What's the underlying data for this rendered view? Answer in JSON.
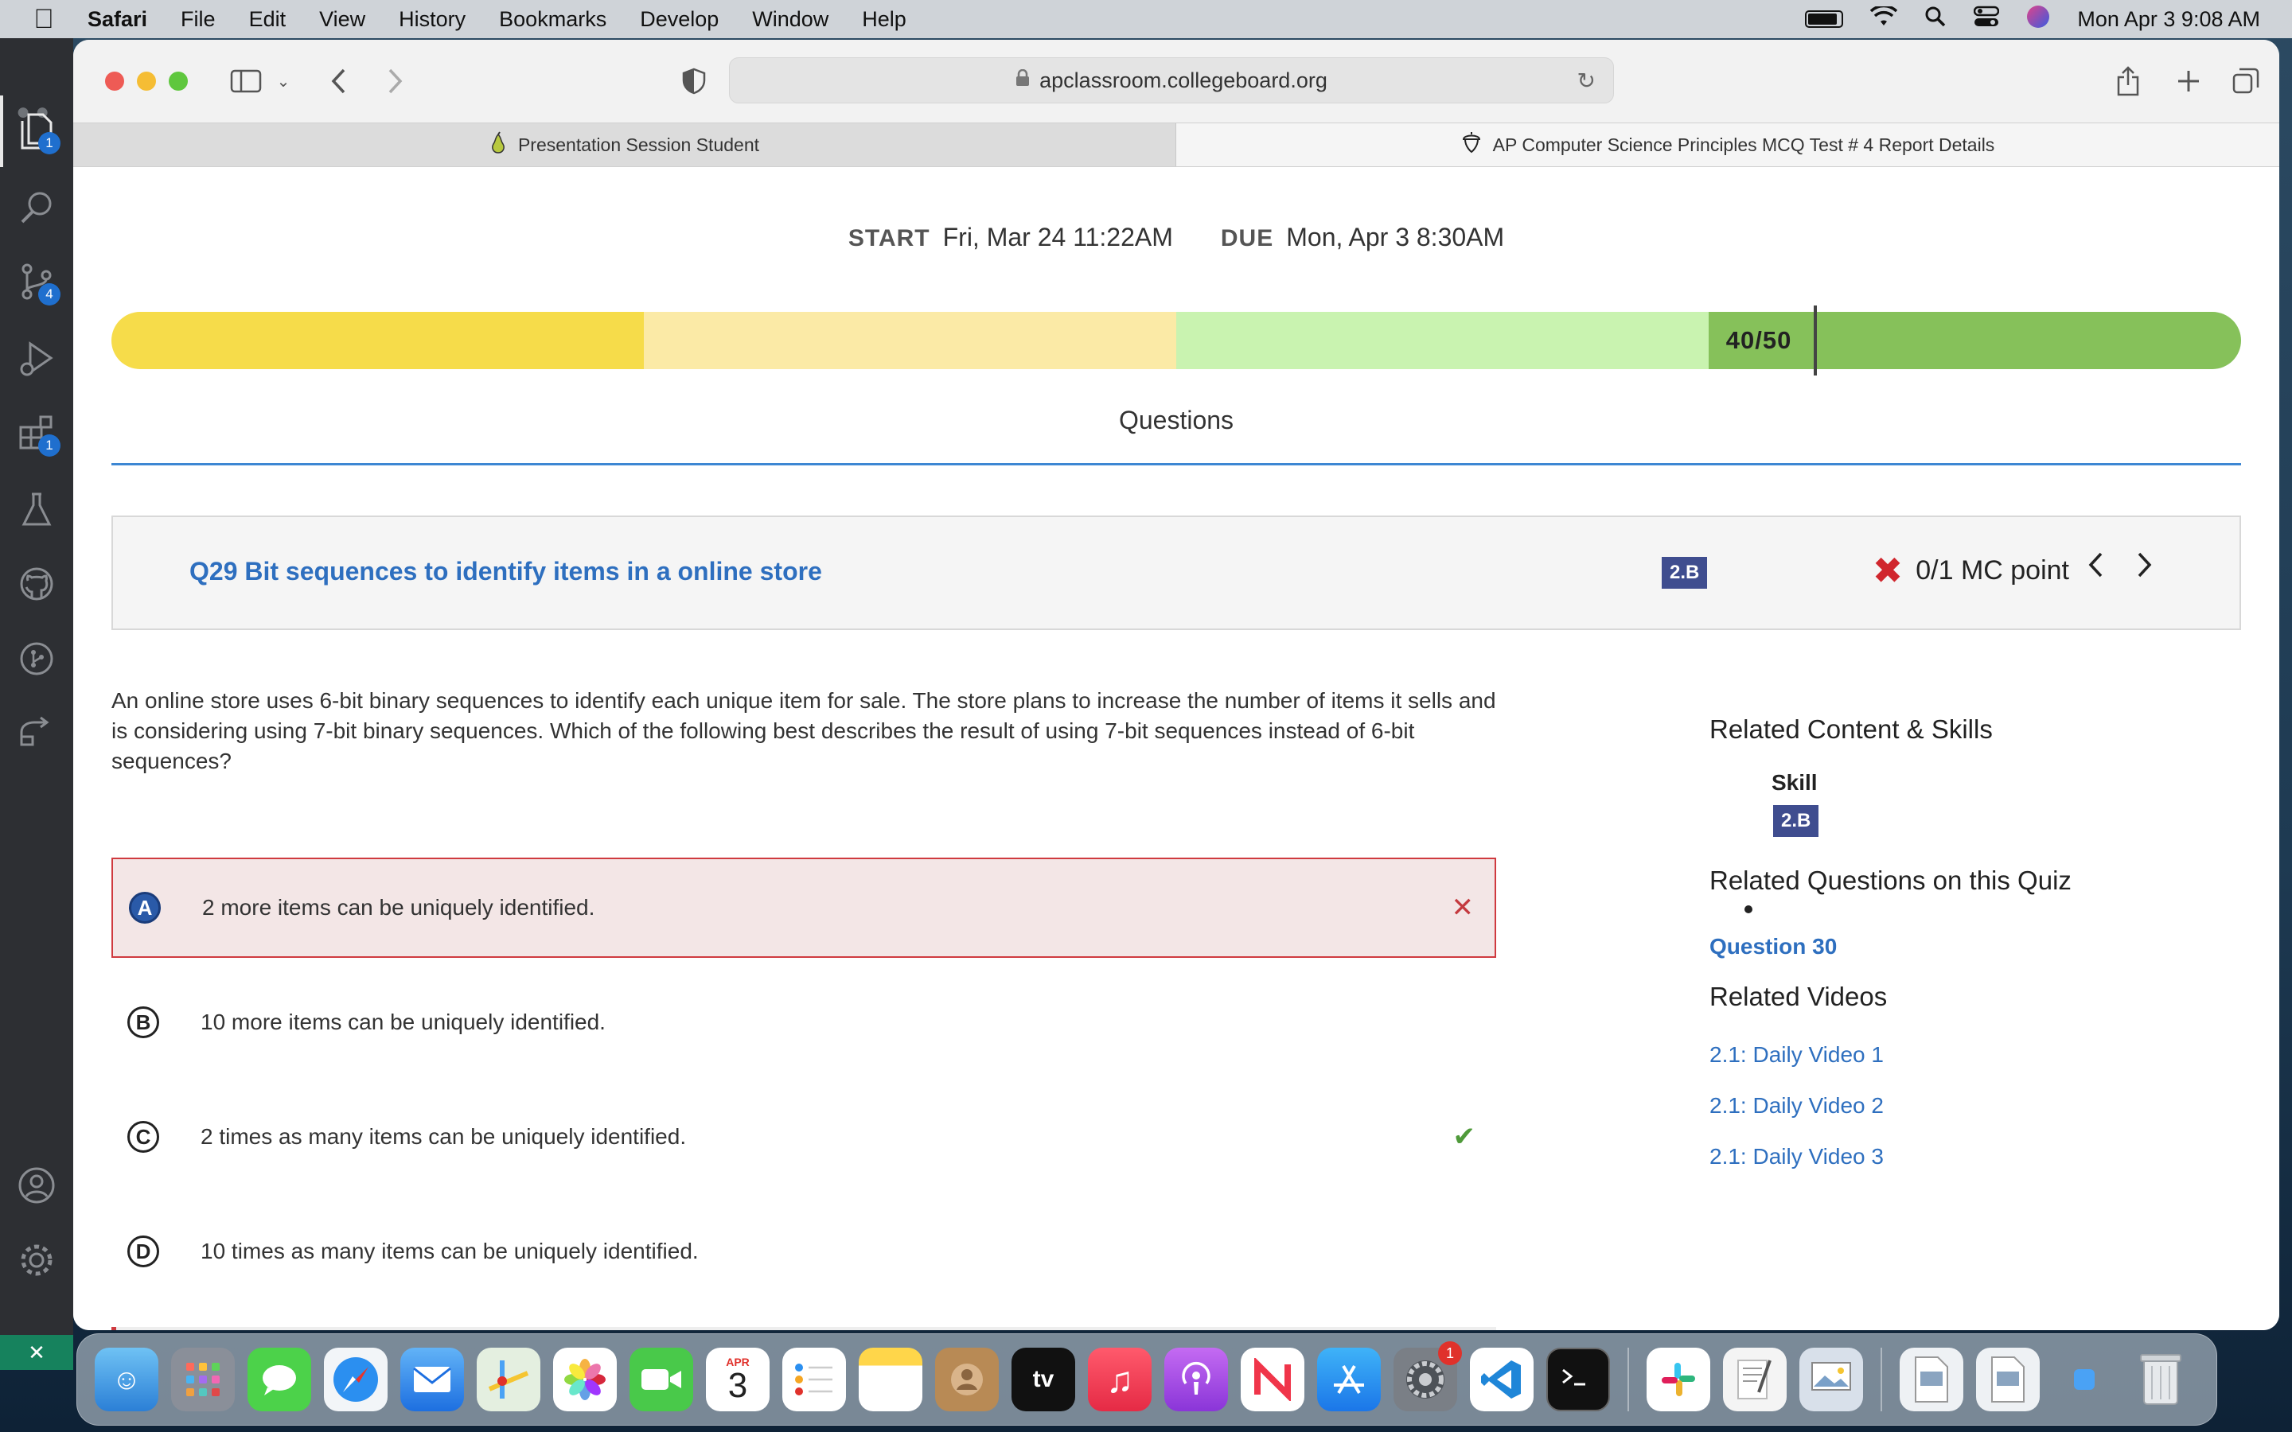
{
  "menubar": {
    "app": "Safari",
    "items": [
      "File",
      "Edit",
      "View",
      "History",
      "Bookmarks",
      "Develop",
      "Window",
      "Help"
    ],
    "clock": "Mon Apr 3  9:08 AM"
  },
  "vscode": {
    "badges": {
      "explorer": "1",
      "scm": "4",
      "extensions": "1"
    }
  },
  "browser": {
    "url": "apclassroom.collegeboard.org",
    "tabs": [
      {
        "label": "Presentation Session Student"
      },
      {
        "label": "AP Computer Science Principles MCQ Test # 4 Report Details"
      }
    ]
  },
  "page": {
    "start_label": "START",
    "start_value": "Fri, Mar 24 11:22AM",
    "due_label": "DUE",
    "due_value": "Mon, Apr 3 8:30AM",
    "score": {
      "text": "40/50",
      "value": 40,
      "max": 50
    },
    "section_title": "Questions",
    "question": {
      "title": "Q29 Bit sequences to identify items in a online store",
      "skill_badge": "2.B",
      "points": "0/1 MC point",
      "prompt": "An online store uses 6-bit binary sequences to identify each unique item for sale. The store plans to increase the number of items it sells and is considering using 7-bit binary sequences. Which of the following best describes the result of using 7-bit sequences instead of 6-bit sequences?",
      "options": [
        {
          "letter": "A",
          "text": "2 more items can be uniquely identified.",
          "state": "selected-wrong"
        },
        {
          "letter": "B",
          "text": "10 more items can be uniquely identified.",
          "state": "none"
        },
        {
          "letter": "C",
          "text": "2 times as many items can be uniquely identified.",
          "state": "correct"
        },
        {
          "letter": "D",
          "text": "10 times as many items can be uniquely identified.",
          "state": "none"
        }
      ]
    },
    "sidebar": {
      "related_content_title": "Related Content & Skills",
      "skill_label": "Skill",
      "skill_badge": "2.B",
      "related_questions_title": "Related Questions on this Quiz",
      "related_question_link": "Question 30",
      "related_videos_title": "Related Videos",
      "videos": [
        "2.1: Daily Video 1",
        "2.1: Daily Video 2",
        "2.1: Daily Video 3"
      ]
    }
  },
  "dock": {
    "calendar_month": "APR",
    "calendar_day": "3",
    "settings_badge": "1"
  },
  "colors": {
    "accent_blue": "#2e6fbf",
    "wrong_red": "#cf3a3f",
    "correct_green": "#4f9a3a",
    "score_segments": [
      "#f6dc4a",
      "#fbeaa6",
      "#c9f3b0",
      "#86c15a"
    ]
  }
}
